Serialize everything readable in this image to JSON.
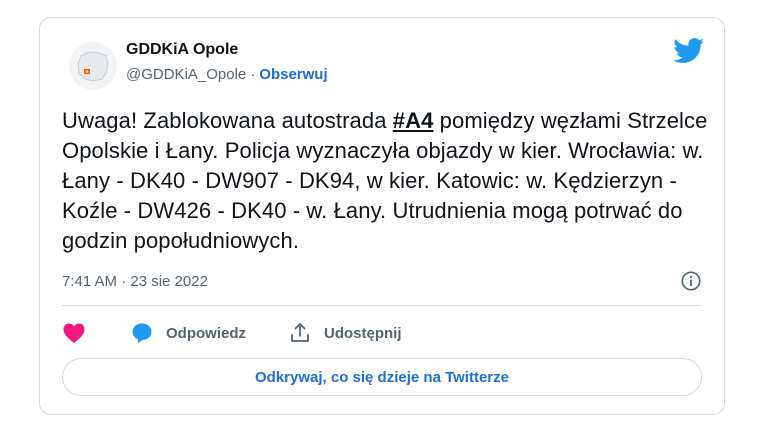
{
  "tweet": {
    "author": {
      "name": "GDDKiA Opole",
      "handle": "@GDDKiA_Opole",
      "separator": "·",
      "follow_label": "Obserwuj",
      "avatar_icon": "poland-map-logo"
    },
    "text": {
      "part1": "Uwaga! Zablokowana autostrada ",
      "hashtag": "#A4",
      "part2": " pomiędzy węzłami Strzelce Opolskie i Łany. Policja wyznaczyła objazdy w kier. Wrocławia: w. Łany - DK40 - DW907 - DK94, w kier. Katowic: w. Kędzierzyn - Koźle - DW426 - DK40 - w. Łany. Utrudnienia mogą potrwać do godzin popołudniowych."
    },
    "timestamp": "7:41 AM · 23 sie 2022",
    "actions": {
      "like_icon": "heart-icon",
      "reply_label": "Odpowiedz",
      "share_label": "Udostępnij"
    },
    "explore_label": "Odkrywaj, co się dzieje na Twitterze"
  },
  "colors": {
    "twitter_blue": "#1d9bf0",
    "link_blue": "#1d6fd6",
    "like_pink": "#f91880",
    "muted_text": "#536471",
    "border": "#cfd9de"
  }
}
